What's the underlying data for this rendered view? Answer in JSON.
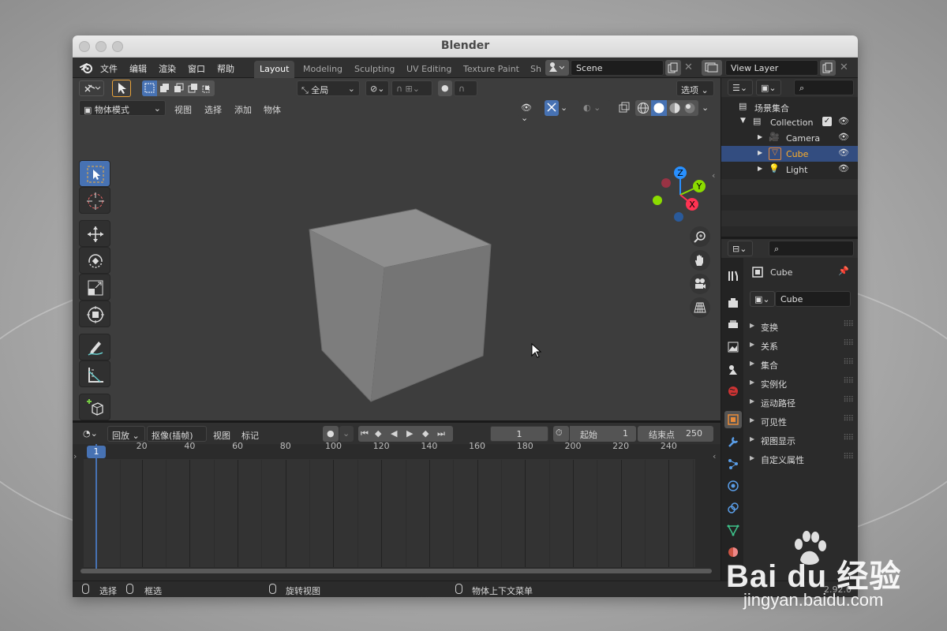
{
  "window": {
    "title": "Blender"
  },
  "menu": [
    "文件",
    "编辑",
    "渲染",
    "窗口",
    "帮助"
  ],
  "workspaces": [
    {
      "label": "Layout",
      "active": true
    },
    {
      "label": "Modeling",
      "active": false
    },
    {
      "label": "Sculpting",
      "active": false
    },
    {
      "label": "UV Editing",
      "active": false
    },
    {
      "label": "Texture Paint",
      "active": false
    },
    {
      "label": "Sh",
      "active": false
    }
  ],
  "scene": {
    "name": "Scene"
  },
  "view_layer": {
    "name": "View Layer"
  },
  "viewport": {
    "transform_orientation": "全局",
    "options_label": "选项",
    "mode": "物体模式",
    "menus": [
      "视图",
      "选择",
      "添加",
      "物体"
    ],
    "gizmo_axes": {
      "z": "Z",
      "y": "Y",
      "x": "X"
    }
  },
  "timeline": {
    "menus": {
      "playback": "回放",
      "keying": "抠像(插帧)",
      "view": "视图",
      "marker": "标记"
    },
    "current_frame": "1",
    "start_label": "起始",
    "start": "1",
    "end_label": "结束点",
    "end": "250",
    "ruler": [
      "1",
      "20",
      "40",
      "60",
      "80",
      "100",
      "120",
      "140",
      "160",
      "180",
      "200",
      "220",
      "240"
    ],
    "playhead": 1,
    "accent": "#4772b3"
  },
  "outliner": {
    "scene_collection": "场景集合",
    "collection": "Collection",
    "items": [
      {
        "label": "Camera",
        "selected": false
      },
      {
        "label": "Cube",
        "selected": true
      },
      {
        "label": "Light",
        "selected": false
      }
    ]
  },
  "properties": {
    "object_name": "Cube",
    "data_name": "Cube",
    "panels": [
      "变换",
      "关系",
      "集合",
      "实例化",
      "运动路径",
      "可见性",
      "视图显示",
      "自定义属性"
    ]
  },
  "statusbar": {
    "select": "选择",
    "box_select": "框选",
    "rotate_view": "旋转视图",
    "context_menu": "物体上下文菜单",
    "version": "2.92.0"
  },
  "watermark": {
    "brand": "Bai du 经验",
    "url": "jingyan.baidu.com"
  },
  "colors": {
    "selected": "#334d80",
    "active_text": "#ffaf29",
    "x_axis": "#ff3352",
    "y_axis": "#8bdc00",
    "z_axis": "#2890ff"
  }
}
